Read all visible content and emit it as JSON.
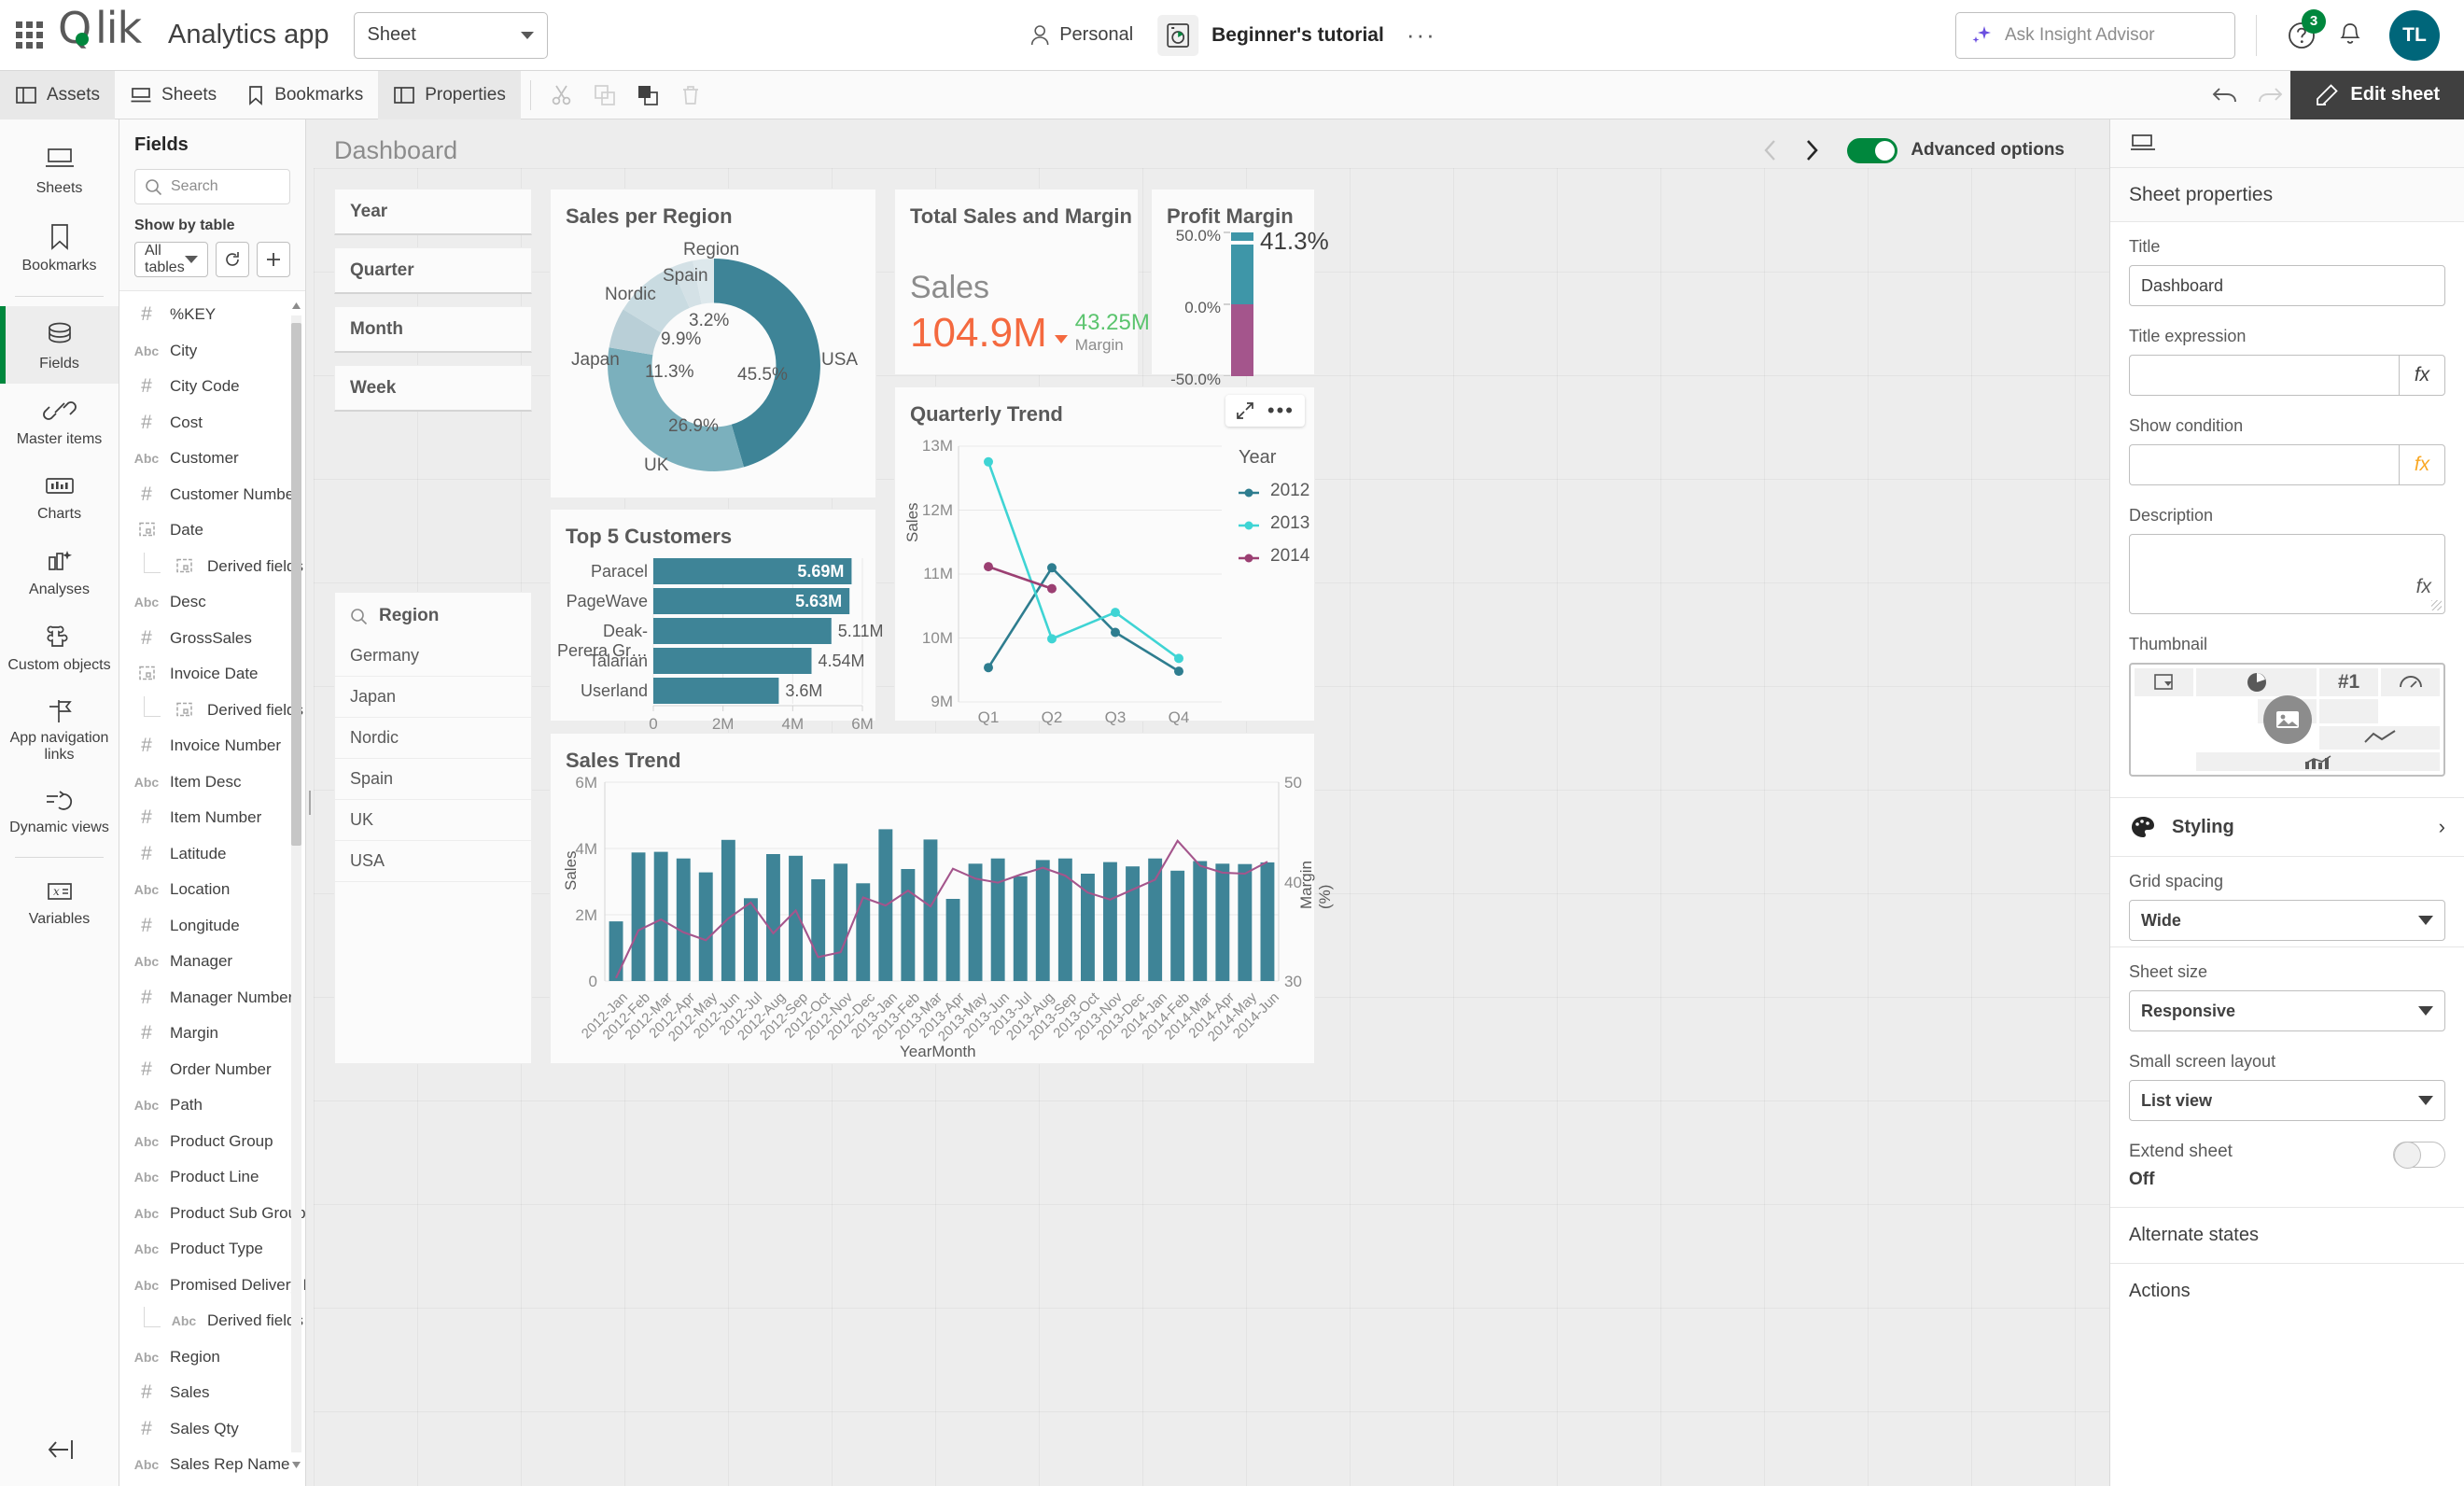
{
  "header": {
    "logo_text": "Qlik",
    "app_title": "Analytics app",
    "sheet_selector": "Sheet",
    "space_label": "Personal",
    "app_name": "Beginner's tutorial",
    "more_dots": "···",
    "insight_placeholder": "Ask Insight Advisor",
    "help_badge": "3",
    "avatar_initials": "TL"
  },
  "toolbar": {
    "assets": "Assets",
    "sheets": "Sheets",
    "bookmarks": "Bookmarks",
    "properties": "Properties",
    "edit_sheet": "Edit sheet"
  },
  "rail": {
    "items": [
      {
        "label": "Sheets",
        "icon": "sheets-icon",
        "active": false
      },
      {
        "label": "Bookmarks",
        "icon": "bookmark-icon",
        "active": false
      },
      {
        "label": "Fields",
        "icon": "database-icon",
        "active": true
      },
      {
        "label": "Master items",
        "icon": "link-icon",
        "active": false
      },
      {
        "label": "Charts",
        "icon": "chart-icon",
        "active": false
      },
      {
        "label": "Analyses",
        "icon": "analyses-icon",
        "active": false
      },
      {
        "label": "Custom objects",
        "icon": "puzzle-icon",
        "active": false
      },
      {
        "label": "App navigation links",
        "icon": "flag-icon",
        "active": false
      },
      {
        "label": "Dynamic views",
        "icon": "dynamic-icon",
        "active": false
      },
      {
        "label": "Variables",
        "icon": "variable-icon",
        "active": false
      }
    ]
  },
  "fields_panel": {
    "title": "Fields",
    "search_placeholder": "Search",
    "show_by_table_label": "Show by table",
    "table_selected": "All tables",
    "fields": [
      {
        "name": "%KEY",
        "type": "#",
        "indent": 0
      },
      {
        "name": "City",
        "type": "Abc",
        "indent": 0
      },
      {
        "name": "City Code",
        "type": "#",
        "indent": 0
      },
      {
        "name": "Cost",
        "type": "#",
        "indent": 0
      },
      {
        "name": "Customer",
        "type": "Abc",
        "indent": 0
      },
      {
        "name": "Customer Number",
        "type": "#",
        "indent": 0
      },
      {
        "name": "Date",
        "type": "date",
        "indent": 0
      },
      {
        "name": "Derived fields",
        "type": "date",
        "indent": 1
      },
      {
        "name": "Desc",
        "type": "Abc",
        "indent": 0
      },
      {
        "name": "GrossSales",
        "type": "#",
        "indent": 0
      },
      {
        "name": "Invoice Date",
        "type": "date",
        "indent": 0
      },
      {
        "name": "Derived fields",
        "type": "date",
        "indent": 1
      },
      {
        "name": "Invoice Number",
        "type": "#",
        "indent": 0
      },
      {
        "name": "Item Desc",
        "type": "Abc",
        "indent": 0
      },
      {
        "name": "Item Number",
        "type": "#",
        "indent": 0
      },
      {
        "name": "Latitude",
        "type": "#",
        "indent": 0
      },
      {
        "name": "Location",
        "type": "Abc",
        "indent": 0
      },
      {
        "name": "Longitude",
        "type": "#",
        "indent": 0
      },
      {
        "name": "Manager",
        "type": "Abc",
        "indent": 0
      },
      {
        "name": "Manager Number",
        "type": "#",
        "indent": 0
      },
      {
        "name": "Margin",
        "type": "#",
        "indent": 0
      },
      {
        "name": "Order Number",
        "type": "#",
        "indent": 0
      },
      {
        "name": "Path",
        "type": "Abc",
        "indent": 0
      },
      {
        "name": "Product Group",
        "type": "Abc",
        "indent": 0
      },
      {
        "name": "Product Line",
        "type": "Abc",
        "indent": 0
      },
      {
        "name": "Product Sub Group",
        "type": "Abc",
        "indent": 0
      },
      {
        "name": "Product Type",
        "type": "Abc",
        "indent": 0
      },
      {
        "name": "Promised Delivery Date",
        "type": "Abc",
        "indent": 0
      },
      {
        "name": "Derived fields",
        "type": "Abc",
        "indent": 1
      },
      {
        "name": "Region",
        "type": "Abc",
        "indent": 0
      },
      {
        "name": "Sales",
        "type": "#",
        "indent": 0
      },
      {
        "name": "Sales Qty",
        "type": "#",
        "indent": 0
      },
      {
        "name": "Sales Rep Name",
        "type": "Abc",
        "indent": 0
      }
    ]
  },
  "sheet": {
    "title": "Dashboard",
    "advanced_options_label": "Advanced options",
    "advanced_options_on": true,
    "filter_boxes": [
      "Year",
      "Quarter",
      "Month",
      "Week"
    ]
  },
  "charts": {
    "donut": {
      "title": "Sales per Region"
    },
    "kpi": {
      "title": "Total Sales and Margin",
      "measure_label": "Sales",
      "value": "104.9M",
      "secondary_value": "43.25M",
      "secondary_label": "Margin"
    },
    "bullet": {
      "title": "Profit Margin",
      "value_label": "41.3%",
      "axis": [
        "50.0%",
        "0.0%",
        "-50.0%"
      ]
    },
    "line": {
      "title": "Quarterly Trend",
      "legend_title": "Year"
    },
    "bar": {
      "title": "Top 5 Customers"
    },
    "trend": {
      "title": "Sales Trend"
    },
    "listbox": {
      "title": "Region",
      "values": [
        "Germany",
        "Japan",
        "Nordic",
        "Spain",
        "UK",
        "USA"
      ]
    }
  },
  "chart_data": [
    {
      "type": "pie",
      "name": "sales-per-region-donut",
      "title": "Sales per Region",
      "legend_title": "Region",
      "labels": [
        "USA",
        "UK",
        "Japan",
        "Nordic",
        "Spain"
      ],
      "values": [
        45.5,
        26.9,
        11.3,
        9.9,
        3.2
      ],
      "value_labels": [
        "45.5%",
        "26.9%",
        "11.3%",
        "9.9%",
        "3.2%"
      ],
      "colors": [
        "#3e8497",
        "#7bb0bd",
        "#b9cfd7",
        "#c9dbe1",
        "#dde8ec"
      ],
      "donut": true
    },
    {
      "type": "bar",
      "name": "profit-margin-bullet",
      "title": "Profit Margin",
      "orientation": "vertical",
      "categories": [
        "Margin"
      ],
      "values": [
        41.3
      ],
      "value_labels": [
        "41.3%"
      ],
      "ylim": [
        -50,
        50
      ],
      "ytick_labels": [
        "50.0%",
        "0.0%",
        "-50.0%"
      ],
      "colors": [
        "#3e96a8",
        "#a4558c"
      ]
    },
    {
      "type": "line",
      "name": "quarterly-trend",
      "title": "Quarterly Trend",
      "xlabel": "",
      "ylabel": "Sales",
      "categories": [
        "Q1",
        "Q2",
        "Q3",
        "Q4"
      ],
      "ylim": [
        9000000,
        13000000
      ],
      "ytick_labels": [
        "9M",
        "10M",
        "11M",
        "12M",
        "13M"
      ],
      "legend_title": "Year",
      "legend_position": "right",
      "series": [
        {
          "name": "2012",
          "color": "#2e7d8f",
          "values": [
            9550000,
            11140000,
            10080000,
            9530000
          ]
        },
        {
          "name": "2013",
          "color": "#3fd4d4",
          "values": [
            12230000,
            10180000,
            10580000,
            9860000
          ]
        },
        {
          "name": "2014",
          "color": "#9b3f72",
          "values": [
            11120000,
            10800000,
            null,
            null
          ]
        }
      ]
    },
    {
      "type": "bar",
      "name": "top-5-customers",
      "title": "Top 5 Customers",
      "orientation": "horizontal",
      "categories": [
        "Paracel",
        "PageWave",
        "Deak-Perera Gr…",
        "Talarian",
        "Userland"
      ],
      "values": [
        5690000,
        5630000,
        5110000,
        4540000,
        3600000
      ],
      "value_labels": [
        "5.69M",
        "5.63M",
        "5.11M",
        "4.54M",
        "3.6M"
      ],
      "xlim": [
        0,
        6000000
      ],
      "xtick_labels": [
        "0",
        "2M",
        "4M",
        "6M"
      ],
      "color": "#3e8497"
    },
    {
      "type": "bar",
      "name": "sales-trend",
      "title": "Sales Trend",
      "xlabel": "YearMonth",
      "ylabel": "Sales",
      "y2label": "Margin (%)",
      "ylim": [
        0,
        6000000
      ],
      "ytick_labels": [
        "0",
        "2M",
        "4M",
        "6M"
      ],
      "y2lim": [
        30,
        50
      ],
      "y2tick_labels": [
        "30",
        "40",
        "50"
      ],
      "bar_color": "#3e8497",
      "line_color": "#a4558c",
      "categories": [
        "2012-Jan",
        "2012-Feb",
        "2012-Mar",
        "2012-Apr",
        "2012-May",
        "2012-Jun",
        "2012-Jul",
        "2012-Aug",
        "2012-Sep",
        "2012-Oct",
        "2012-Nov",
        "2012-Dec",
        "2013-Jan",
        "2013-Feb",
        "2013-Mar",
        "2013-Apr",
        "2013-May",
        "2013-Jun",
        "2013-Jul",
        "2013-Aug",
        "2013-Sep",
        "2013-Oct",
        "2013-Nov",
        "2013-Dec",
        "2014-Jan",
        "2014-Feb",
        "2014-Mar",
        "2014-Apr",
        "2014-May",
        "2014-Jun"
      ],
      "series": [
        {
          "name": "Sales",
          "kind": "bar",
          "values": [
            1800000,
            3880000,
            3900000,
            3700000,
            3280000,
            4260000,
            2500000,
            3830000,
            3780000,
            3070000,
            3540000,
            2950000,
            4580000,
            3380000,
            4270000,
            2480000,
            3540000,
            3700000,
            3160000,
            3650000,
            3700000,
            3240000,
            3590000,
            3460000,
            3700000,
            3330000,
            3620000,
            3540000,
            3530000,
            3580000
          ]
        },
        {
          "name": "Margin (%)",
          "kind": "line",
          "values": [
            30.3,
            35.1,
            36.2,
            34.9,
            34.1,
            36.3,
            37.9,
            34.8,
            37.1,
            32.4,
            32.9,
            38.4,
            37.6,
            39.1,
            37.5,
            41.3,
            40.3,
            39.9,
            40.7,
            41.4,
            40.6,
            38.9,
            38.2,
            39.2,
            40.2,
            44.1,
            41.6,
            40.9,
            40.8,
            42.0
          ]
        }
      ]
    }
  ],
  "properties": {
    "header": "Sheet properties",
    "title_label": "Title",
    "title_value": "Dashboard",
    "title_expression_label": "Title expression",
    "title_expression_value": "",
    "show_condition_label": "Show condition",
    "show_condition_value": "",
    "description_label": "Description",
    "description_value": "",
    "thumbnail_label": "Thumbnail",
    "thumbnail_badge": "#1",
    "styling_label": "Styling",
    "grid_spacing_label": "Grid spacing",
    "grid_spacing_value": "Wide",
    "sheet_size_label": "Sheet size",
    "sheet_size_value": "Responsive",
    "small_screen_label": "Small screen layout",
    "small_screen_value": "List view",
    "extend_sheet_label": "Extend sheet",
    "extend_sheet_value": "Off",
    "alternate_states": "Alternate states",
    "actions": "Actions",
    "fx": "fx"
  },
  "colors": {
    "accent_green": "#00873d",
    "teal": "#3e8497",
    "orange": "#f4693f",
    "green_text": "#5bc46e",
    "purple": "#9b3f72",
    "cyan": "#3fd4d4"
  }
}
